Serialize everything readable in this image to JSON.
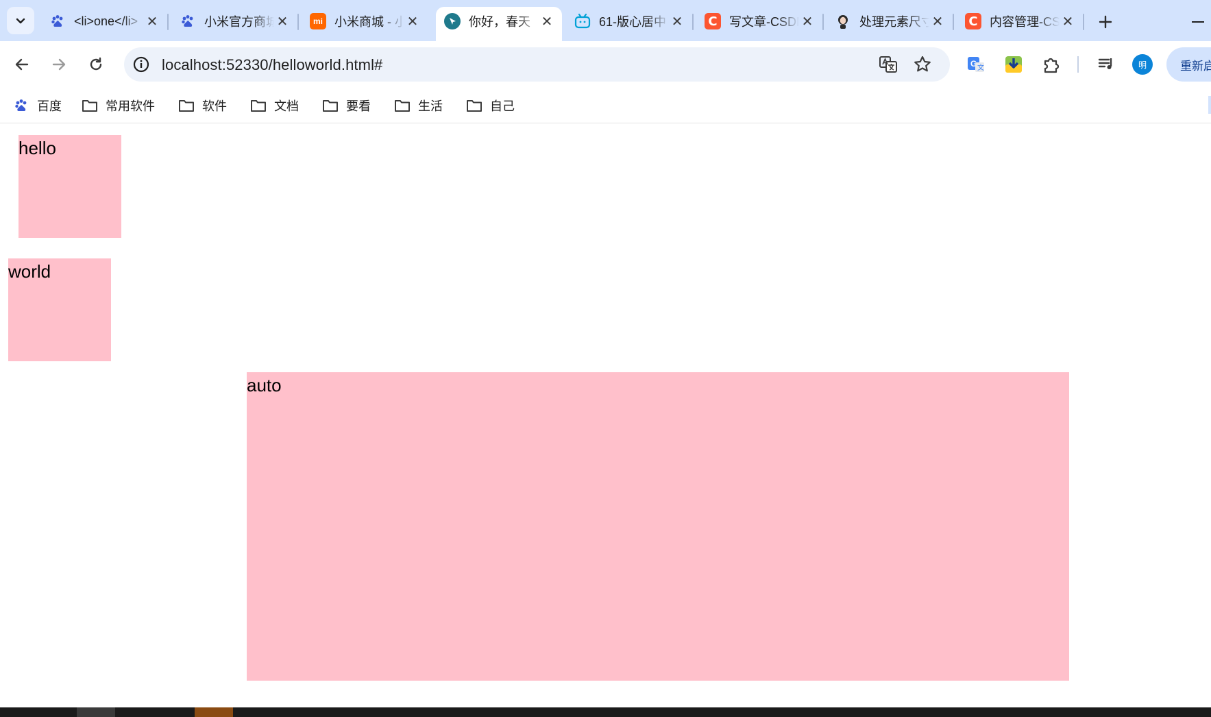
{
  "tabs": [
    {
      "title": "<li>one</li>",
      "icon": "baidu-paw-icon",
      "color": "#3b5bd6",
      "active": false
    },
    {
      "title": "小米官方商城",
      "icon": "baidu-paw-icon",
      "color": "#3b5bd6",
      "active": false
    },
    {
      "title": "小米商城 - 小米",
      "icon": "mi-logo-icon",
      "color": "#ff6700",
      "active": false
    },
    {
      "title": "你好，春天",
      "icon": "cursor-logo-icon",
      "color": "#1f7a8c",
      "active": true
    },
    {
      "title": "61-版心居中",
      "icon": "bilibili-tv-icon",
      "color": "#00a1d6",
      "active": false
    },
    {
      "title": "写文章-CSDN",
      "icon": "csdn-c-icon",
      "color": "#fc5531",
      "active": false
    },
    {
      "title": "处理元素尺寸",
      "icon": "avatar-face-icon",
      "color": "#444444",
      "active": false
    },
    {
      "title": "内容管理-CSDN",
      "icon": "csdn-c-icon",
      "color": "#fc5531",
      "active": false
    }
  ],
  "address_bar": {
    "url": "localhost:52330/helloworld.html#"
  },
  "profile": {
    "initial": "明",
    "color": "#0b84d8"
  },
  "relaunch_label": "重新启动",
  "bookmarks": [
    {
      "label": "百度",
      "icon": "baidu-paw-icon"
    },
    {
      "label": "常用软件",
      "icon": "folder-icon"
    },
    {
      "label": "软件",
      "icon": "folder-icon"
    },
    {
      "label": "文档",
      "icon": "folder-icon"
    },
    {
      "label": "要看",
      "icon": "folder-icon"
    },
    {
      "label": "生活",
      "icon": "folder-icon"
    },
    {
      "label": "自己",
      "icon": "folder-icon"
    }
  ],
  "page": {
    "boxes": [
      {
        "text": "hello",
        "color": "#ffc0cb"
      },
      {
        "text": "world",
        "color": "#ffc0cb"
      },
      {
        "text": "auto",
        "color": "#ffc0cb"
      }
    ]
  },
  "colors": {
    "tabstrip_bg": "#d3e3fd",
    "omnibox_bg": "#edf2fa",
    "box_pink": "#ffc0cb"
  }
}
